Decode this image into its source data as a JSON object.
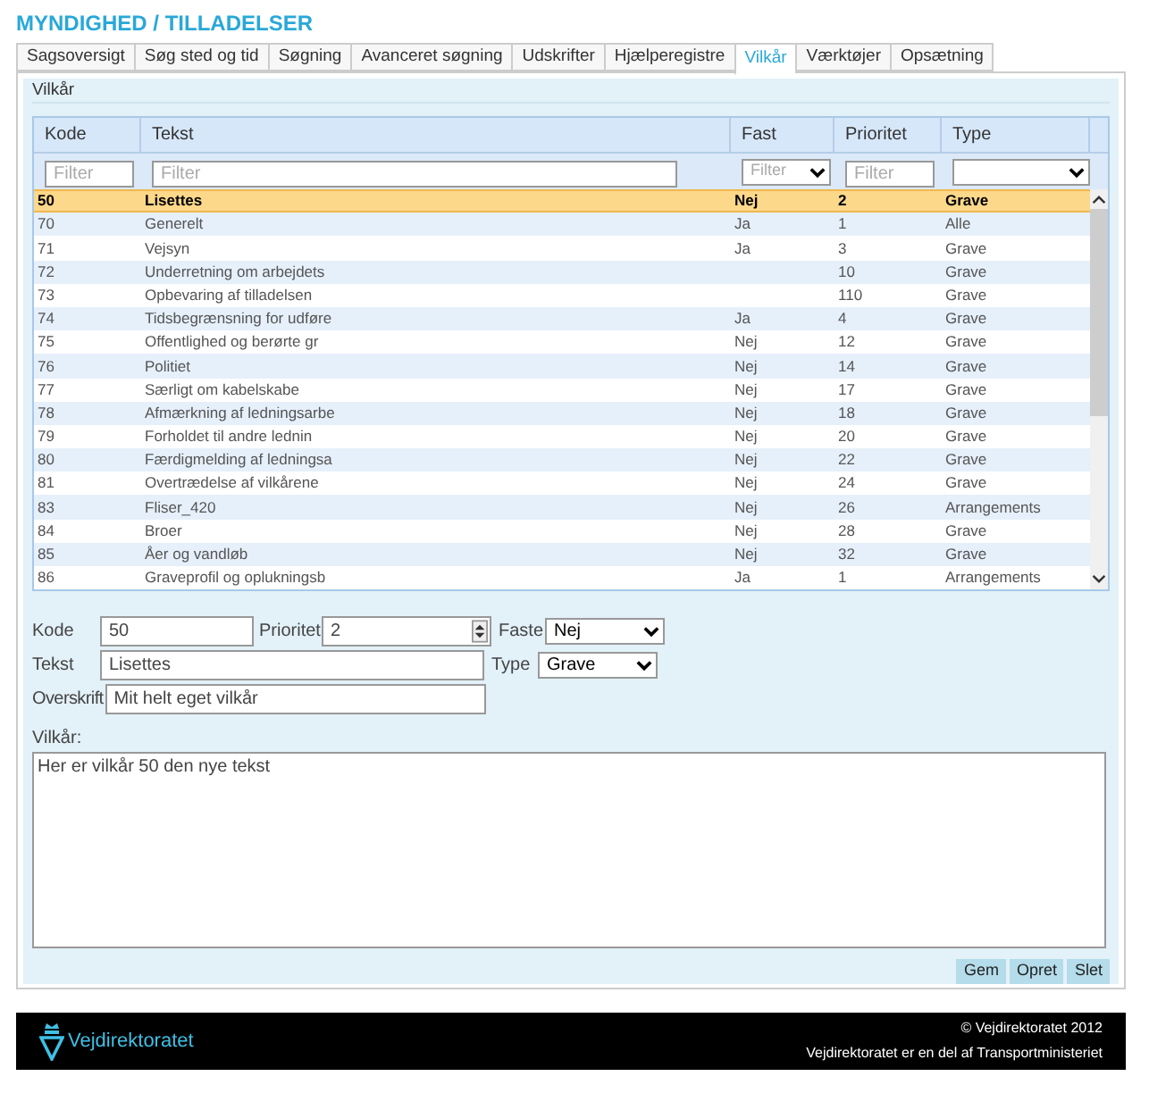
{
  "header": {
    "title": "MYNDIGHED / TILLADELSER"
  },
  "tabs": [
    {
      "label": "Sagsoversigt",
      "selected": false
    },
    {
      "label": "Søg sted og tid",
      "selected": false
    },
    {
      "label": "Søgning",
      "selected": false
    },
    {
      "label": "Avanceret søgning",
      "selected": false
    },
    {
      "label": "Udskrifter",
      "selected": false
    },
    {
      "label": "Hjælperegistre",
      "selected": false
    },
    {
      "label": "Vilkår",
      "selected": true
    },
    {
      "label": "Værktøjer",
      "selected": false
    },
    {
      "label": "Opsætning",
      "selected": false
    }
  ],
  "panel": {
    "title": "Vilkår"
  },
  "table": {
    "columns": [
      {
        "label": "Kode",
        "filter": {
          "kind": "text",
          "placeholder": "Filter"
        }
      },
      {
        "label": "Tekst",
        "filter": {
          "kind": "text",
          "placeholder": "Filter"
        }
      },
      {
        "label": "Fast",
        "filter": {
          "kind": "select",
          "placeholder": "Filter"
        }
      },
      {
        "label": "Prioritet",
        "filter": {
          "kind": "text",
          "placeholder": "Filter"
        }
      },
      {
        "label": "Type",
        "filter": {
          "kind": "select"
        }
      }
    ],
    "rows": [
      {
        "kode": "50",
        "tekst": "Lisettes",
        "fast": "Nej",
        "prioritet": "2",
        "type": "Grave",
        "selected": true
      },
      {
        "kode": "70",
        "tekst": "Generelt",
        "fast": "Ja",
        "prioritet": "1",
        "type": "Alle",
        "selected": false
      },
      {
        "kode": "71",
        "tekst": "Vejsyn",
        "fast": "Ja",
        "prioritet": "3",
        "type": "Grave",
        "selected": false
      },
      {
        "kode": "72",
        "tekst": "Underretning om arbejdets",
        "prioritet": "10",
        "type": "Grave",
        "selected": false
      },
      {
        "kode": "73",
        "tekst": "Opbevaring af tilladelsen",
        "prioritet": "110",
        "type": "Grave",
        "selected": false
      },
      {
        "kode": "74",
        "tekst": "Tidsbegrænsning for udføre",
        "fast": "Ja",
        "prioritet": "4",
        "type": "Grave",
        "selected": false
      },
      {
        "kode": "75",
        "tekst": "Offentlighed og berørte gr",
        "fast": "Nej",
        "prioritet": "12",
        "type": "Grave",
        "selected": false
      },
      {
        "kode": "76",
        "tekst": "Politiet",
        "fast": "Nej",
        "prioritet": "14",
        "type": "Grave",
        "selected": false
      },
      {
        "kode": "77",
        "tekst": "Særligt om kabelskabe",
        "fast": "Nej",
        "prioritet": "17",
        "type": "Grave",
        "selected": false
      },
      {
        "kode": "78",
        "tekst": "Afmærkning af ledningsarbe",
        "fast": "Nej",
        "prioritet": "18",
        "type": "Grave",
        "selected": false
      },
      {
        "kode": "79",
        "tekst": "Forholdet til andre lednin",
        "fast": "Nej",
        "prioritet": "20",
        "type": "Grave",
        "selected": false
      },
      {
        "kode": "80",
        "tekst": "Færdigmelding af ledningsa",
        "fast": "Nej",
        "prioritet": "22",
        "type": "Grave",
        "selected": false
      },
      {
        "kode": "81",
        "tekst": "Overtrædelse af vilkårene",
        "fast": "Nej",
        "prioritet": "24",
        "type": "Grave",
        "selected": false
      },
      {
        "kode": "83",
        "tekst": "Fliser_420",
        "fast": "Nej",
        "prioritet": "26",
        "type": "Arrangements",
        "selected": false
      },
      {
        "kode": "84",
        "tekst": "Broer",
        "fast": "Nej",
        "prioritet": "28",
        "type": "Grave",
        "selected": false
      },
      {
        "kode": "85",
        "tekst": "Åer og vandløb",
        "fast": "Nej",
        "prioritet": "32",
        "type": "Grave",
        "selected": false
      },
      {
        "kode": "86",
        "tekst": "Graveprofil og oplukningsb",
        "fast": "Ja",
        "prioritet": "1",
        "type": "Arrangements",
        "selected": false
      }
    ]
  },
  "form": {
    "kode": {
      "label": "Kode",
      "value": "50"
    },
    "prioritet": {
      "label": "Prioritet",
      "value": "2"
    },
    "faste": {
      "label": "Faste",
      "value": "Nej"
    },
    "tekst": {
      "label": "Tekst",
      "value": "Lisettes"
    },
    "type": {
      "label": "Type",
      "value": "Grave"
    },
    "overskrift": {
      "label": "Overskrift",
      "value": "Mit helt eget vilkår"
    },
    "vilkaar": {
      "label": "Vilkår:",
      "value": "Her er vilkår 50 den nye tekst"
    }
  },
  "buttons": [
    "Gem",
    "Opret",
    "Slet"
  ],
  "footer": {
    "logo": "Vejdirektoratet",
    "copyright": "© Vejdirektoratet 2012",
    "note": "Vejdirektoratet er en del af Transportministeriet"
  }
}
